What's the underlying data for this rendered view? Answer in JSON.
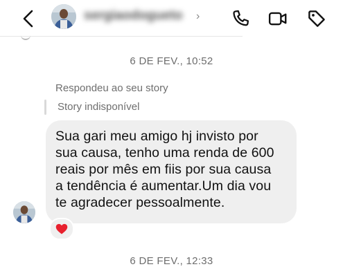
{
  "header": {
    "username": "sergiaodogueto",
    "username_chevron": "›",
    "icons": [
      "back-icon",
      "avatar",
      "phone-icon",
      "video-icon",
      "tag-icon"
    ]
  },
  "chat": {
    "timestamp_1": "6 DE FEV., 10:52",
    "replied_label": "Respondeu ao seu story",
    "story_unavailable": "Story indisponível",
    "message_text": "Sua gari meu amigo hj invisto por\nsua causa, tenho uma renda de 600\nreais por mês em fiis por sua causa\na tendência é aumentar.Um dia vou\nte agradecer pessoalmente.",
    "reaction_emoji": "heart-icon",
    "timestamp_2": "6 DE FEV., 12:33"
  },
  "colors": {
    "bubble": "#efefef",
    "reaction_heart": "#e8212e",
    "meta_text": "#6d6d6d"
  }
}
